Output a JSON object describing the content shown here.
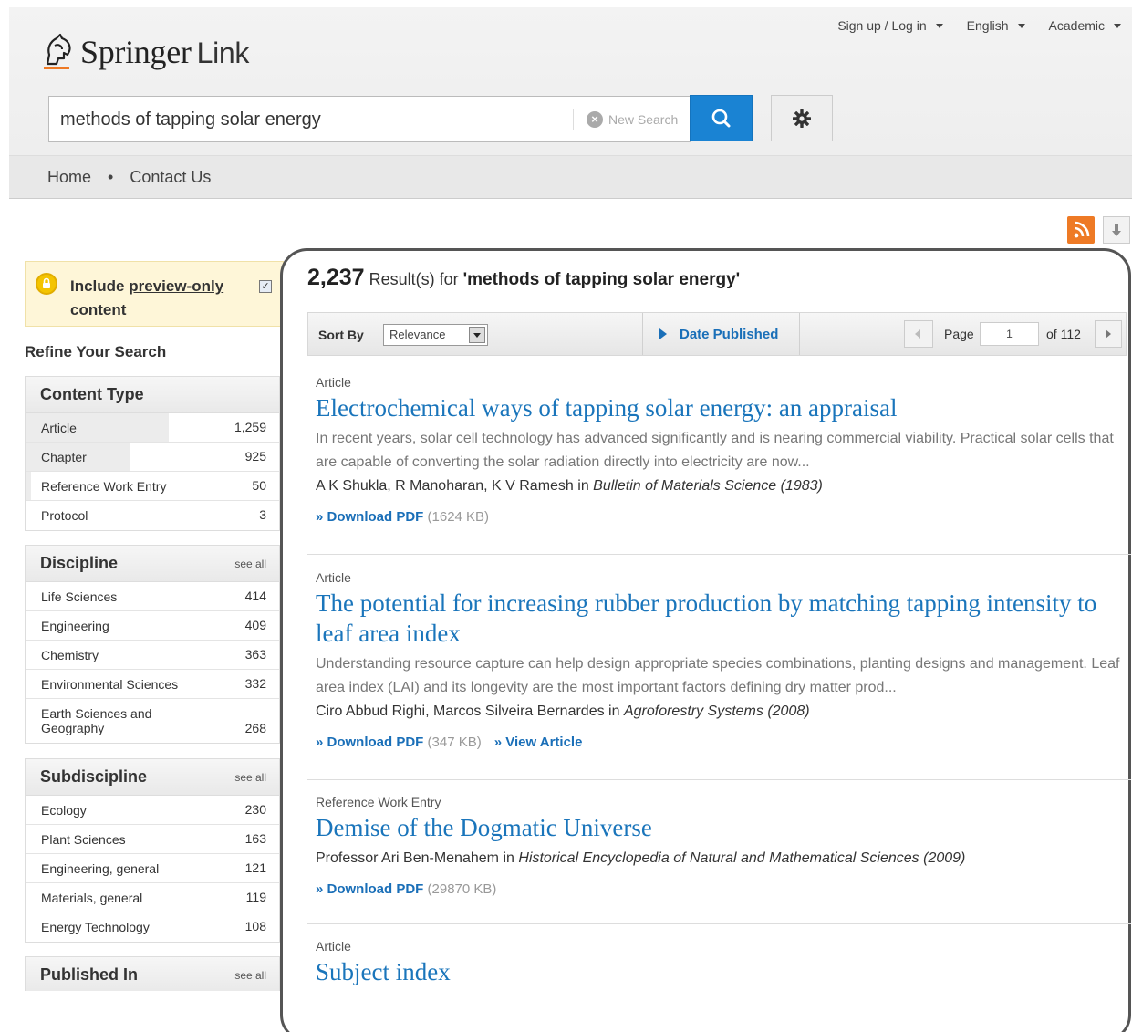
{
  "header": {
    "brand": "Springer",
    "brand_suffix": "Link",
    "top_links": [
      {
        "label": "Sign up / Log in"
      },
      {
        "label": "English"
      },
      {
        "label": "Academic"
      }
    ]
  },
  "search": {
    "value": "methods of tapping solar energy",
    "new_search_label": "New Search"
  },
  "nav": {
    "items": [
      "Home",
      "Contact Us"
    ],
    "separator": "•"
  },
  "sidebar": {
    "preview_label_pre": "Include ",
    "preview_label_link": "preview-only",
    "preview_label_post": "content",
    "preview_checked": true,
    "refine_title": "Refine Your Search",
    "content_type": {
      "title": "Content Type",
      "items": [
        {
          "label": "Article",
          "count": "1,259",
          "share": 0.57
        },
        {
          "label": "Chapter",
          "count": "925",
          "share": 0.41
        },
        {
          "label": "Reference Work Entry",
          "count": "50",
          "share": 0.02
        },
        {
          "label": "Protocol",
          "count": "3",
          "share": 0
        }
      ]
    },
    "discipline": {
      "title": "Discipline",
      "see_all": "see all",
      "items": [
        {
          "label": "Life Sciences",
          "count": "414"
        },
        {
          "label": "Engineering",
          "count": "409"
        },
        {
          "label": "Chemistry",
          "count": "363"
        },
        {
          "label": "Environmental Sciences",
          "count": "332"
        },
        {
          "label": "Earth Sciences and Geography",
          "count": "268"
        }
      ]
    },
    "subdiscipline": {
      "title": "Subdiscipline",
      "see_all": "see all",
      "items": [
        {
          "label": "Ecology",
          "count": "230"
        },
        {
          "label": "Plant Sciences",
          "count": "163"
        },
        {
          "label": "Engineering, general",
          "count": "121"
        },
        {
          "label": "Materials, general",
          "count": "119"
        },
        {
          "label": "Energy Technology",
          "count": "108"
        }
      ]
    },
    "published_in": {
      "title": "Published In",
      "see_all": "see all"
    }
  },
  "results": {
    "count": "2,237",
    "count_label": "Result(s) for",
    "query": "'methods of tapping solar energy'",
    "sort_label": "Sort By",
    "sort_value": "Relevance",
    "date_published": "Date Published",
    "page_label": "Page",
    "page_value": "1",
    "of_label": "of 112",
    "items": [
      {
        "type": "Article",
        "title": "Electrochemical ways of tapping solar energy: an appraisal",
        "snippet": "In recent years, solar cell technology has advanced significantly and is nearing commercial viability. Practical solar cells that are capable of converting the solar radiation directly into electricity are now...",
        "authors": "A K Shukla, R Manoharan, K V Ramesh",
        "in": "in",
        "source": "Bulletin of Materials Science (1983)",
        "download": "» Download PDF",
        "size": "(1624 KB)"
      },
      {
        "type": "Article",
        "title": "The potential for increasing rubber production by matching tapping intensity to leaf area index",
        "snippet": "Understanding resource capture can help design appropriate species combinations, planting designs and management. Leaf area index (LAI) and its longevity are the most important factors defining dry matter prod...",
        "authors": "Ciro Abbud Righi, Marcos Silveira Bernardes",
        "in": "in",
        "source": "Agroforestry Systems (2008)",
        "download": "» Download PDF",
        "size": "(347 KB)",
        "view": "» View Article"
      },
      {
        "type": "Reference Work Entry",
        "title": "Demise of the Dogmatic Universe",
        "authors": "Professor Ari Ben-Menahem",
        "in": "in",
        "source": "Historical Encyclopedia of Natural and Mathematical Sciences (2009)",
        "download": "» Download PDF",
        "size": "(29870 KB)"
      },
      {
        "type": "Article",
        "title": "Subject index"
      }
    ]
  },
  "colors": {
    "link": "#1a75bb",
    "search_button": "#1a83d3",
    "rss": "#ee7a25",
    "preview_bg": "#fef6d8",
    "frame": "#555555"
  }
}
